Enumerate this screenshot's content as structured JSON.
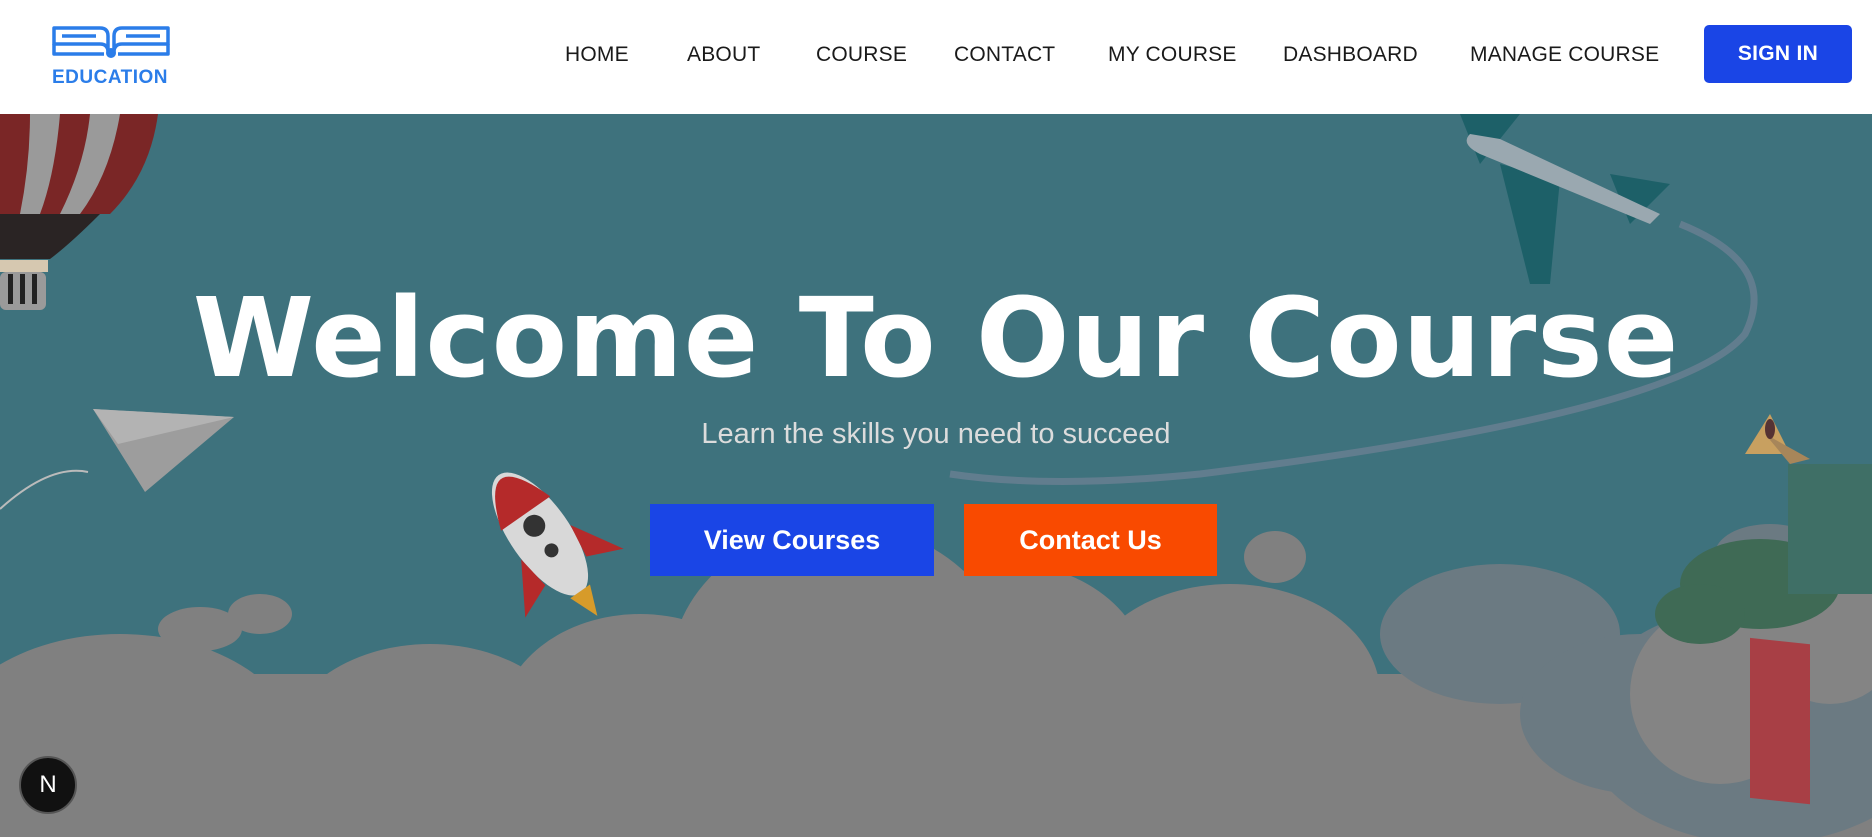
{
  "header": {
    "logo_text": "EDUCATION",
    "nav": [
      {
        "label": "HOME"
      },
      {
        "label": "ABOUT"
      },
      {
        "label": "COURSE"
      },
      {
        "label": "CONTACT"
      },
      {
        "label": "MY COURSE"
      },
      {
        "label": "DASHBOARD"
      },
      {
        "label": "MANAGE COURSE"
      }
    ],
    "signin_label": "SIGN IN"
  },
  "hero": {
    "title": "Welcome To Our Course",
    "subtitle": "Learn the skills you need to succeed",
    "view_courses_label": "View Courses",
    "contact_us_label": "Contact Us"
  },
  "badge": {
    "letter": "N"
  },
  "colors": {
    "brand_blue": "#1a45e6",
    "accent_orange": "#f94a00",
    "logo_blue": "#2b7de9",
    "hero_bg": "#3e727d"
  }
}
